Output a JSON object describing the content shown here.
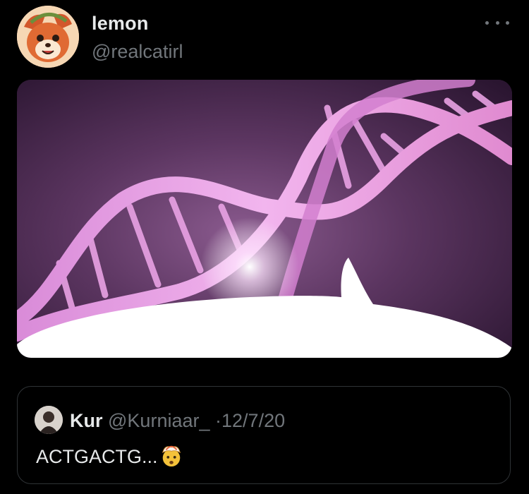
{
  "tweet": {
    "author_name": "lemon",
    "author_handle": "@realcatirl",
    "avatar_icon": "cartoon-fox-avatar",
    "more_icon": "more-dots-icon",
    "media_description_icon": "dna-helix-image"
  },
  "quoted_tweet": {
    "author_name": "Kur",
    "author_handle": "@Kurniaar_",
    "separator": "·",
    "date": "12/7/20",
    "text": "ACTGACTG...",
    "emoji_icon": "exploding-head-emoji"
  },
  "colors": {
    "background": "#000000",
    "primary_text": "#e7e9ea",
    "secondary_text": "#71767b",
    "border": "#2f3336"
  }
}
